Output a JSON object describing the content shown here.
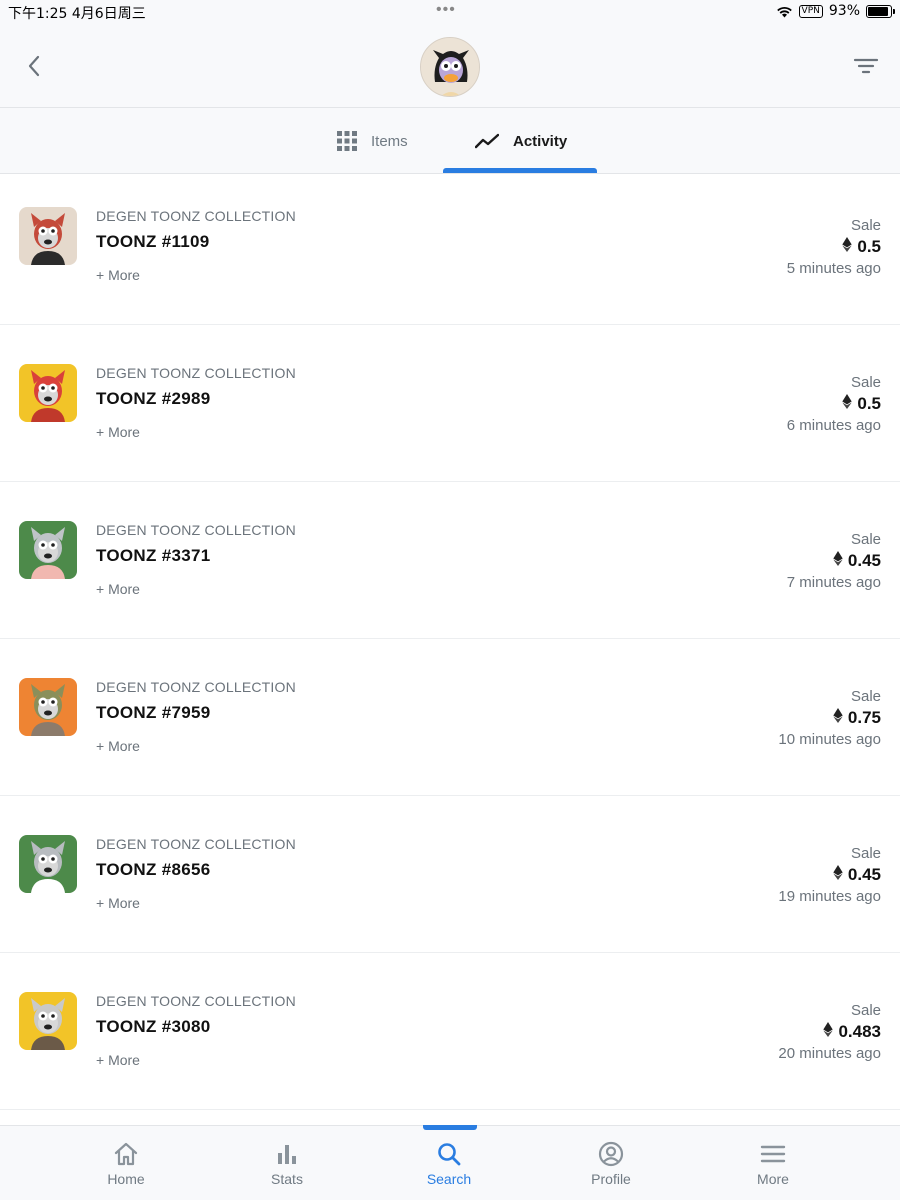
{
  "status_bar": {
    "time": "下午1:25   4月6日周三",
    "dots": "•••",
    "vpn": "VPN",
    "battery": "93%",
    "battery_level": 0.93
  },
  "header": {
    "back_icon": "chevron-left-icon",
    "filter_icon": "filter-lines-icon"
  },
  "tabs": [
    {
      "label": "Items",
      "icon": "grid-icon",
      "active": false
    },
    {
      "label": "Activity",
      "icon": "trend-line-icon",
      "active": true
    }
  ],
  "activity": [
    {
      "collection": "DEGEN TOONZ COLLECTION",
      "name": "TOONZ #1109",
      "more": "+ More",
      "event": "Sale",
      "price": "0.5",
      "time": "5 minutes ago",
      "bg": "#e5d9cc"
    },
    {
      "collection": "DEGEN TOONZ COLLECTION",
      "name": "TOONZ #2989",
      "more": "+ More",
      "event": "Sale",
      "price": "0.5",
      "time": "6 minutes ago",
      "bg": "#f2c428"
    },
    {
      "collection": "DEGEN TOONZ COLLECTION",
      "name": "TOONZ #3371",
      "more": "+ More",
      "event": "Sale",
      "price": "0.45",
      "time": "7 minutes ago",
      "bg": "#4d8a4a"
    },
    {
      "collection": "DEGEN TOONZ COLLECTION",
      "name": "TOONZ #7959",
      "more": "+ More",
      "event": "Sale",
      "price": "0.75",
      "time": "10 minutes ago",
      "bg": "#ee8433"
    },
    {
      "collection": "DEGEN TOONZ COLLECTION",
      "name": "TOONZ #8656",
      "more": "+ More",
      "event": "Sale",
      "price": "0.45",
      "time": "19 minutes ago",
      "bg": "#4d8a4a"
    },
    {
      "collection": "DEGEN TOONZ COLLECTION",
      "name": "TOONZ #3080",
      "more": "+ More",
      "event": "Sale",
      "price": "0.483",
      "time": "20 minutes ago",
      "bg": "#f2c428"
    }
  ],
  "bottom_nav": [
    {
      "label": "Home",
      "icon": "home-icon",
      "active": false
    },
    {
      "label": "Stats",
      "icon": "bar-chart-icon",
      "active": false
    },
    {
      "label": "Search",
      "icon": "search-icon",
      "active": true
    },
    {
      "label": "Profile",
      "icon": "profile-icon",
      "active": false
    },
    {
      "label": "More",
      "icon": "menu-icon",
      "active": false
    }
  ],
  "colors": {
    "accent": "#2a7de1",
    "muted_text": "#707a83",
    "bar_bg": "#f8f9fb"
  }
}
